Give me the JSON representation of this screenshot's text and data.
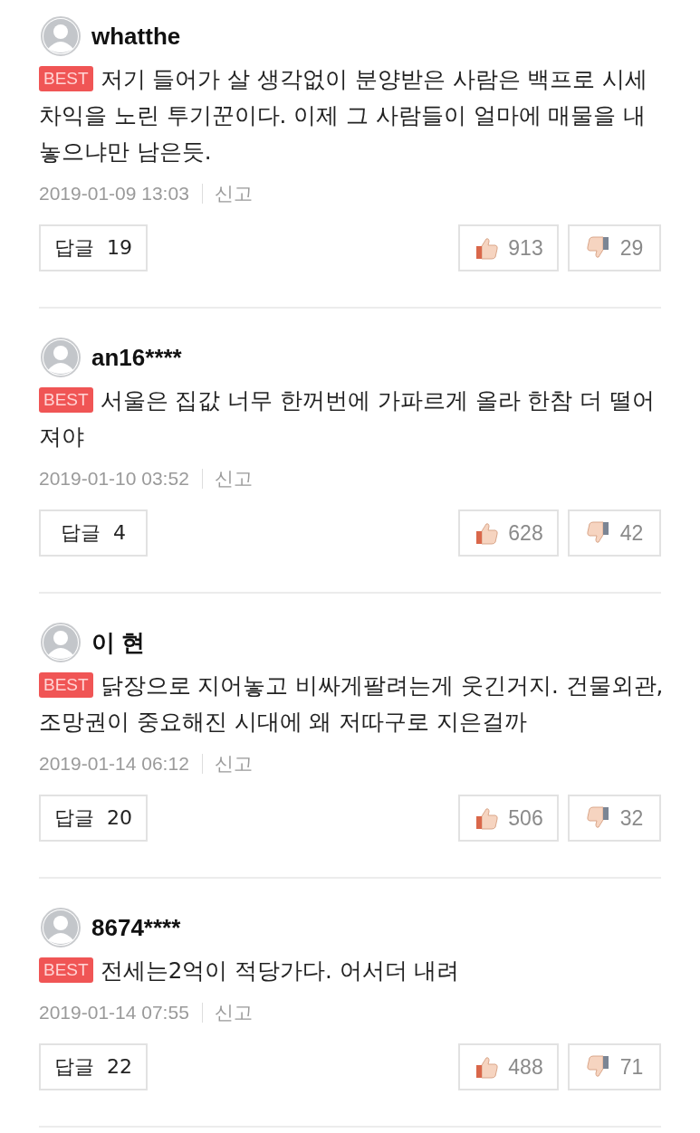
{
  "comments": [
    {
      "username": "whatthe",
      "badge": "BEST",
      "text": "저기 들어가 살 생각없이 분양받은 사람은 백프로 시세차익을 노린 투기꾼이다. 이제 그 사람들이 얼마에 매물을 내놓으냐만 남은듯.",
      "date": "2019-01-09 13:03",
      "report": "신고",
      "reply_label": "답글",
      "reply_count": "19",
      "likes": "913",
      "dislikes": "29"
    },
    {
      "username": "an16****",
      "badge": "BEST",
      "text": "서울은 집값 너무 한꺼번에 가파르게 올라 한참 더 떨어져야",
      "date": "2019-01-10 03:52",
      "report": "신고",
      "reply_label": "답글",
      "reply_count": "4",
      "likes": "628",
      "dislikes": "42"
    },
    {
      "username": "이 현",
      "badge": "BEST",
      "text": "닭장으로 지어놓고 비싸게팔려는게 웃긴거지. 건물외관, 조망권이 중요해진 시대에 왜 저따구로 지은걸까",
      "date": "2019-01-14 06:12",
      "report": "신고",
      "reply_label": "답글",
      "reply_count": "20",
      "likes": "506",
      "dislikes": "32"
    },
    {
      "username": "8674****",
      "badge": "BEST",
      "text": "전세는2억이 적당가다. 어서더 내려",
      "date": "2019-01-14 07:55",
      "report": "신고",
      "reply_label": "답글",
      "reply_count": "22",
      "likes": "488",
      "dislikes": "71"
    }
  ]
}
